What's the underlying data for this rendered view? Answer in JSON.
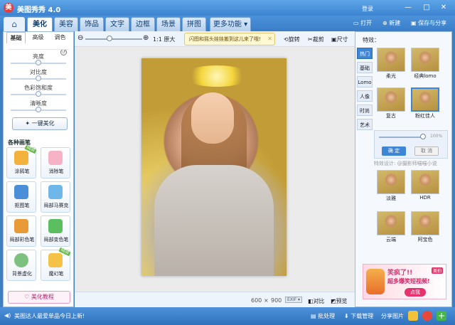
{
  "app": {
    "title": "美图秀秀 4.0",
    "logo_text": "美"
  },
  "window": {
    "login": "登录",
    "minimize": "—",
    "maximize": "□",
    "close": "✕"
  },
  "tabs": [
    {
      "label": "美化"
    },
    {
      "label": "美容"
    },
    {
      "label": "饰品"
    },
    {
      "label": "文字"
    },
    {
      "label": "边框"
    },
    {
      "label": "场景"
    },
    {
      "label": "拼图"
    },
    {
      "label": "更多功能 ▾"
    }
  ],
  "header_actions": {
    "open": "打开",
    "new": "新建",
    "save_share": "保存与分享"
  },
  "left": {
    "subtabs": [
      "基础",
      "高级",
      "调色"
    ],
    "sliders": [
      {
        "label": "亮度",
        "value": 0.5
      },
      {
        "label": "对比度",
        "value": 0.5
      },
      {
        "label": "色彩饱和度",
        "value": 0.5
      },
      {
        "label": "清晰度",
        "value": 0.5
      }
    ],
    "one_click": "一键美化",
    "brushes_title": "各种画笔",
    "brushes": [
      {
        "label": "涂鸦笔",
        "tag": "NEW"
      },
      {
        "label": "消除笔"
      },
      {
        "label": "抠图笔"
      },
      {
        "label": "局部马赛克"
      },
      {
        "label": "局部彩色笔"
      },
      {
        "label": "局部变色笔"
      },
      {
        "label": "背景虚化"
      },
      {
        "label": "魔幻笔",
        "tag": "NEW"
      }
    ],
    "tutorial": "美化教程"
  },
  "toolbar": {
    "actual_size": "1:1 原大",
    "tip": "闪图和摇头娃娃搬到这儿来了哦!",
    "rotate": "旋转",
    "crop": "裁剪",
    "resize": "尺寸"
  },
  "canvas": {
    "width": "600",
    "times": "×",
    "height": "900",
    "exif": "EXIF ▾",
    "compare": "对比",
    "preview": "预览"
  },
  "right": {
    "title": "特效：",
    "categories": [
      "热门",
      "基础",
      "Lomo",
      "人像",
      "时尚",
      "艺术"
    ],
    "effects_top": [
      {
        "label": "柔光"
      },
      {
        "label": "经典lomo"
      },
      {
        "label": "复古"
      },
      {
        "label": "粉红佳人"
      }
    ],
    "opacity": {
      "value": "100%"
    },
    "ok": "确 定",
    "cancel": "取 消",
    "designer": "特效设计: @摄影师喵喵小说",
    "effects_bottom": [
      {
        "label": "淡雅"
      },
      {
        "label": "HDR"
      },
      {
        "label": "云端"
      },
      {
        "label": "阿宝色"
      }
    ],
    "ad": {
      "line1": "笑疯了!!",
      "line2": "超多爆笑短视频!",
      "cta": "点我",
      "badge": "美拍"
    }
  },
  "bottom": {
    "news": "美图达人最爱单品今日上新!",
    "batch": "批处理",
    "download": "下载管理",
    "share": "分享图片"
  }
}
